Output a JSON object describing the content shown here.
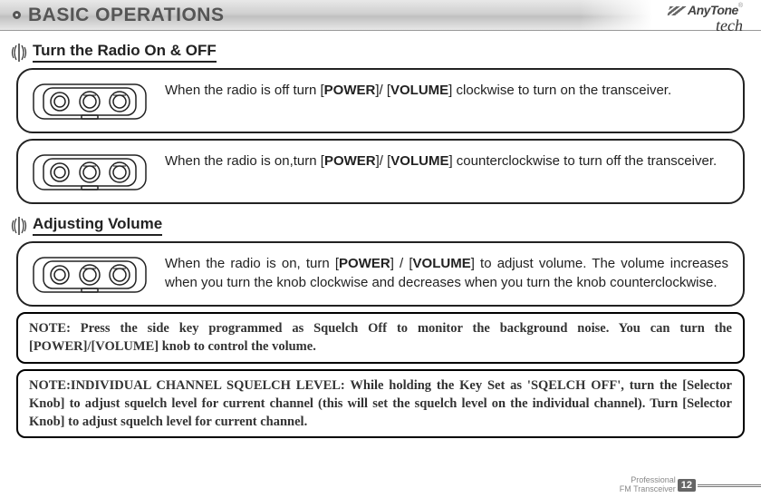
{
  "header": {
    "title": "BASIC OPERATIONS",
    "brand_main": "AnyTone",
    "brand_sub": "tech"
  },
  "sections": {
    "s1": {
      "title": "Turn the Radio On & OFF"
    },
    "s2": {
      "title": "Adjusting Volume"
    }
  },
  "cards": {
    "c1": {
      "pre": "When the radio is off turn [",
      "k1": "POWER",
      "mid": "]/ [",
      "k2": "VOLUME",
      "post": "] clockwise to turn on the transceiver."
    },
    "c2": {
      "pre": "When the radio is on,turn [",
      "k1": "POWER",
      "mid": "]/ [",
      "k2": "VOLUME",
      "post": "] counterclockwise to turn off the transceiver."
    },
    "c3": {
      "pre": "When the radio is on, turn [",
      "k1": "POWER",
      "mid": "] / [",
      "k2": "VOLUME",
      "post": "] to adjust volume. The volume increases when you turn the knob clockwise and decreases when you turn the knob counterclockwise."
    }
  },
  "notes": {
    "n1": "NOTE: Press the side key programmed as Squelch Off to monitor the background noise. You can turn the [POWER]/[VOLUME] knob to control the volume.",
    "n2": "NOTE:INDIVIDUAL CHANNEL SQUELCH LEVEL: While holding the Key Set as 'SQELCH OFF', turn the [Selector Knob] to adjust squelch level for current channel (this will set the squelch level on the individual channel). Turn [Selector Knob] to adjust squelch level for current channel."
  },
  "footer": {
    "line1": "Professional",
    "line2": "FM Transceiver",
    "page": "12"
  }
}
